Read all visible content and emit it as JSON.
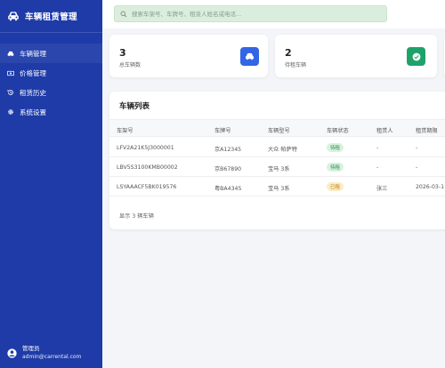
{
  "app": {
    "title": "车辆租赁管理"
  },
  "sidebar": {
    "items": [
      {
        "label": "车辆管理",
        "icon": "car-icon"
      },
      {
        "label": "价格管理",
        "icon": "money-icon"
      },
      {
        "label": "租赁历史",
        "icon": "history-icon"
      },
      {
        "label": "系统设置",
        "icon": "gear-icon"
      }
    ],
    "user": {
      "name": "管理员",
      "email": "admin@carrental.com"
    }
  },
  "search": {
    "placeholder": "搜索车架号、车牌号、租赁人姓名或电话..."
  },
  "stats": [
    {
      "value": "3",
      "label": "总车辆数",
      "color": "#3366e6"
    },
    {
      "value": "2",
      "label": "待租车辆",
      "color": "#1fa26a"
    }
  ],
  "table": {
    "title": "车辆列表",
    "columns": [
      "车架号",
      "车牌号",
      "车辆型号",
      "车辆状态",
      "租赁人",
      "租赁期限"
    ],
    "rows": [
      {
        "vin": "LFV2A21K5J3000001",
        "plate": "京A12345",
        "model": "大众 帕萨特",
        "status": "待租",
        "renter": "-",
        "period": "-"
      },
      {
        "vin": "LBV5S3100KMB00002",
        "plate": "京B67890",
        "model": "宝马 3系",
        "status": "待租",
        "renter": "-",
        "period": "-"
      },
      {
        "vin": "LSYAAACF5BK019576",
        "plate": "粤BA4345",
        "model": "宝马 3系",
        "status": "已租",
        "renter": "张三",
        "period": "2026-03-1"
      }
    ],
    "footer": "显示 3 辆车辆"
  }
}
